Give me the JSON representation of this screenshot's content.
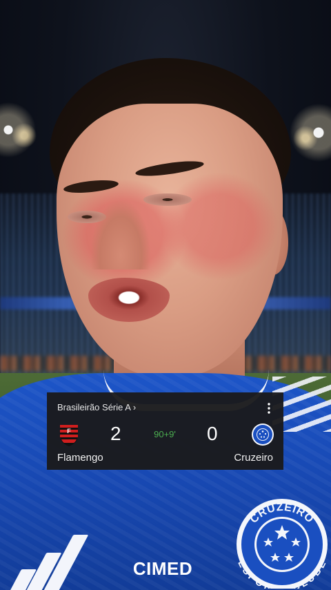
{
  "scoreboard": {
    "league": "Brasileirão Série A",
    "league_chevron": "›",
    "home_team": "Flamengo",
    "away_team": "Cruzeiro",
    "home_score": "2",
    "away_score": "0",
    "match_time": "90+9'",
    "home_logo_icon": "flamengo-crest-icon",
    "away_logo_icon": "cruzeiro-crest-icon",
    "more_icon": "more-vertical-icon"
  },
  "jersey": {
    "sponsor": "CIMED",
    "crest_top_text": "CRUZEIRO",
    "crest_bottom_text": "ESPORTE CLUBE"
  },
  "colors": {
    "time_green": "#4caf50",
    "card_bg": "#1a1a1c",
    "cruzeiro_blue": "#1d55c8",
    "flamengo_red": "#d01e1e"
  }
}
